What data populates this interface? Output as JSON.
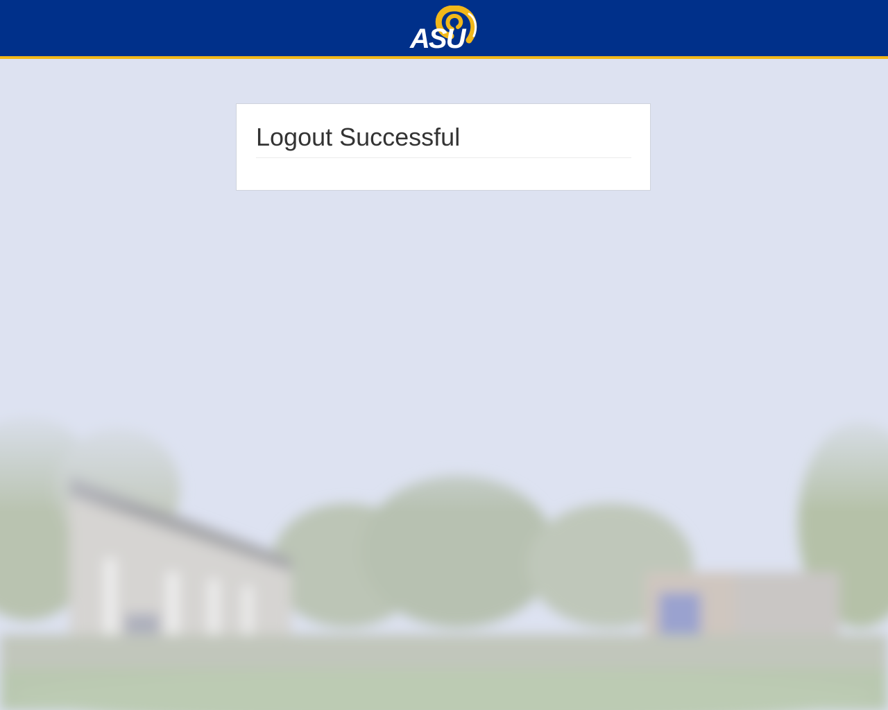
{
  "header": {
    "logo_text": "ASU",
    "colors": {
      "bar": "#00308a",
      "stripe": "#f2b81a",
      "logo_gold": "#f2b81a",
      "logo_text": "#ffffff"
    }
  },
  "main": {
    "title": "Logout Successful"
  },
  "background": {
    "image": "blurred-campus-building-photo"
  }
}
